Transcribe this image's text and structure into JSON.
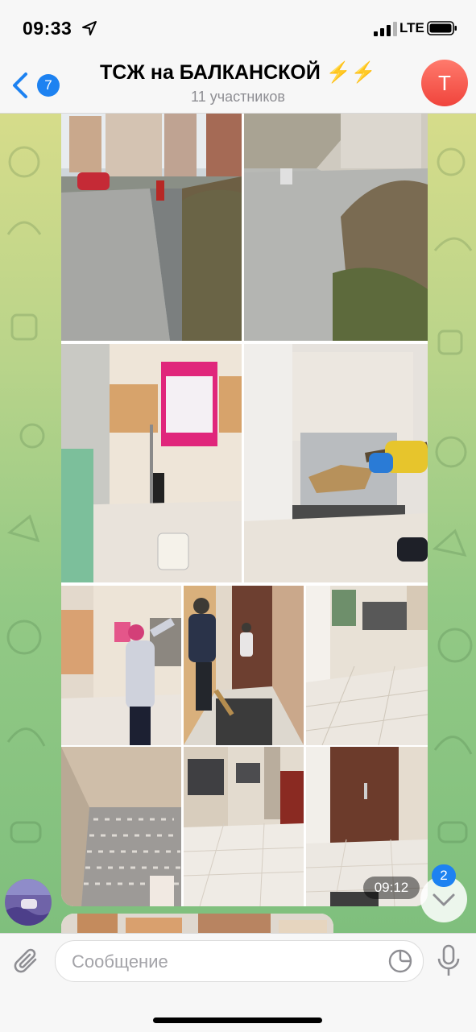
{
  "status_bar": {
    "time": "09:33",
    "network": "LTE",
    "location_icon": "location-arrow-icon",
    "signal_icon": "signal-bars-icon",
    "battery_icon": "battery-icon"
  },
  "header": {
    "back_badge": "7",
    "title": "ТСЖ на БАЛКАНСКОЙ ⚡️⚡️",
    "subtitle": "11 участников",
    "avatar_letter": "Т",
    "back_icon": "chevron-left-icon"
  },
  "message": {
    "time": "09:12",
    "photos": [
      {
        "name": "photo-street-sidewalk"
      },
      {
        "name": "photo-courtyard-stairs"
      },
      {
        "name": "photo-elevator-hall-poster"
      },
      {
        "name": "photo-elevator-cleaning"
      },
      {
        "name": "photo-cleaner-wiping-wall"
      },
      {
        "name": "photo-residents-corridor"
      },
      {
        "name": "photo-mailbox-hall"
      },
      {
        "name": "photo-elevator-floor"
      },
      {
        "name": "photo-mailboxes-corridor"
      },
      {
        "name": "photo-brown-door-hall"
      }
    ]
  },
  "scroll_down": {
    "badge": "2",
    "icon": "chevron-down-icon"
  },
  "composer": {
    "placeholder": "Сообщение",
    "attach_icon": "paperclip-icon",
    "sticker_icon": "sticker-icon",
    "mic_icon": "microphone-icon"
  },
  "colors": {
    "accent": "#1d82f1",
    "avatar": "#f0443c"
  }
}
